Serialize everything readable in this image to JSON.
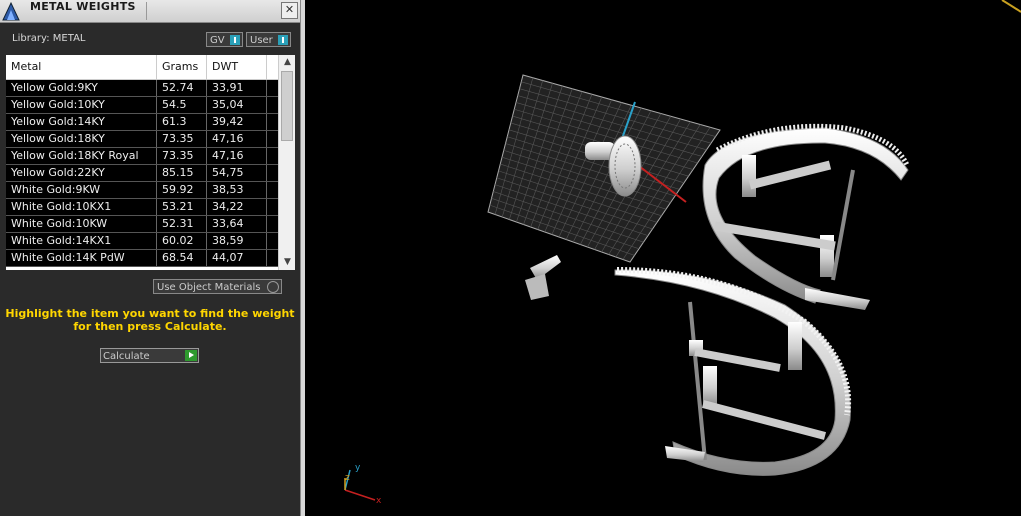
{
  "window": {
    "title": "METAL WEIGHTS",
    "close_glyph": "✕"
  },
  "library": {
    "label": "Library: METAL"
  },
  "filters": {
    "gv_label": "GV",
    "user_label": "User"
  },
  "table": {
    "headers": [
      "Metal",
      "Grams",
      "DWT"
    ],
    "rows": [
      [
        "Yellow Gold:9KY",
        "52.74",
        "33,91"
      ],
      [
        "Yellow Gold:10KY",
        "54.5",
        "35,04"
      ],
      [
        "Yellow Gold:14KY",
        "61.3",
        "39,42"
      ],
      [
        "Yellow Gold:18KY",
        "73.35",
        "47,16"
      ],
      [
        "Yellow Gold:18KY Royal",
        "73.35",
        "47,16"
      ],
      [
        "Yellow Gold:22KY",
        "85.15",
        "54,75"
      ],
      [
        "White Gold:9KW",
        "59.92",
        "38,53"
      ],
      [
        "White Gold:10KX1",
        "53.21",
        "34,22"
      ],
      [
        "White Gold:10KW",
        "52.31",
        "33,64"
      ],
      [
        "White Gold:14KX1",
        "60.02",
        "38,59"
      ],
      [
        "White Gold:14K PdW",
        "68.54",
        "44,07"
      ]
    ]
  },
  "options": {
    "use_object_materials": "Use Object Materials"
  },
  "hint": {
    "line1": "Highlight the item you want to find the weight",
    "line2": "for then press Calculate."
  },
  "actions": {
    "calculate": "Calculate"
  },
  "viewport": {
    "axis_y": "y",
    "axis_x": "x",
    "axis_z": "z"
  },
  "colors": {
    "hint": "#ffd600",
    "accent": "#2aa0b8",
    "go": "#2e9a2e"
  }
}
